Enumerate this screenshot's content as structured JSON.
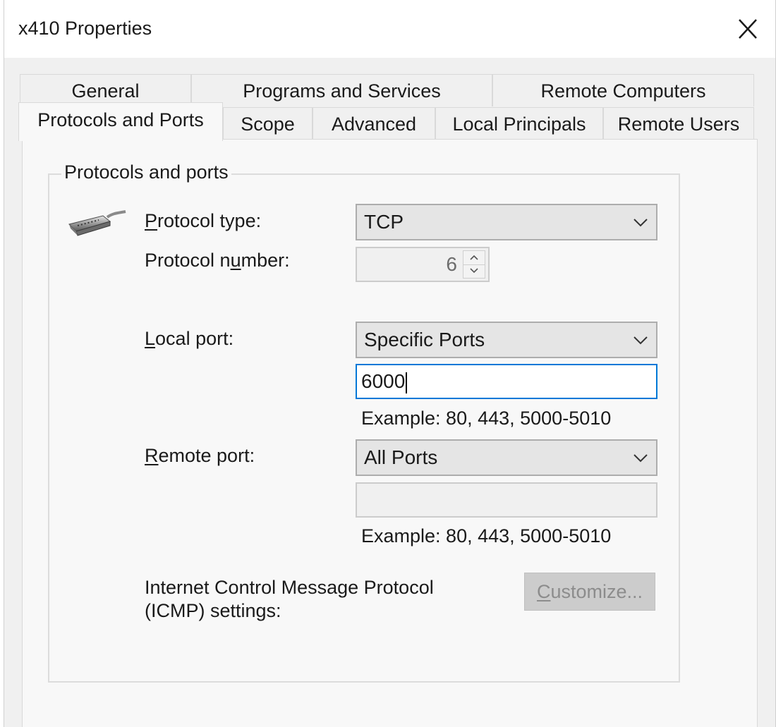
{
  "window": {
    "title": "x410 Properties",
    "close_icon": "close-icon"
  },
  "tabs": {
    "row1": [
      "General",
      "Programs and Services",
      "Remote Computers"
    ],
    "row2": [
      "Protocols and Ports",
      "Scope",
      "Advanced",
      "Local Principals",
      "Remote Users"
    ],
    "active": "Protocols and Ports"
  },
  "group": {
    "title": "Protocols and ports",
    "icon": "serial-cable-icon"
  },
  "protocol_type": {
    "label_pre": "",
    "label_key": "P",
    "label_post": "rotocol type:",
    "value": "TCP"
  },
  "protocol_number": {
    "label_pre": "Protocol n",
    "label_key": "u",
    "label_post": "mber:",
    "value": "6"
  },
  "local_port": {
    "label_pre": "",
    "label_key": "L",
    "label_post": "ocal port:",
    "selection": "Specific Ports",
    "value": "6000",
    "example": "Example: 80, 443, 5000-5010"
  },
  "remote_port": {
    "label_pre": "",
    "label_key": "R",
    "label_post": "emote port:",
    "selection": "All Ports",
    "value": "",
    "example": "Example: 80, 443, 5000-5010"
  },
  "icmp": {
    "label_line1": "Internet Control Message Protocol",
    "label_line2": "(ICMP) settings:",
    "button_key": "C",
    "button_rest": "ustomize...",
    "button_enabled": false
  },
  "colors": {
    "focus_border": "#0078d7",
    "panel_bg": "#f8f8f8",
    "window_bg": "#f0f0f0"
  }
}
